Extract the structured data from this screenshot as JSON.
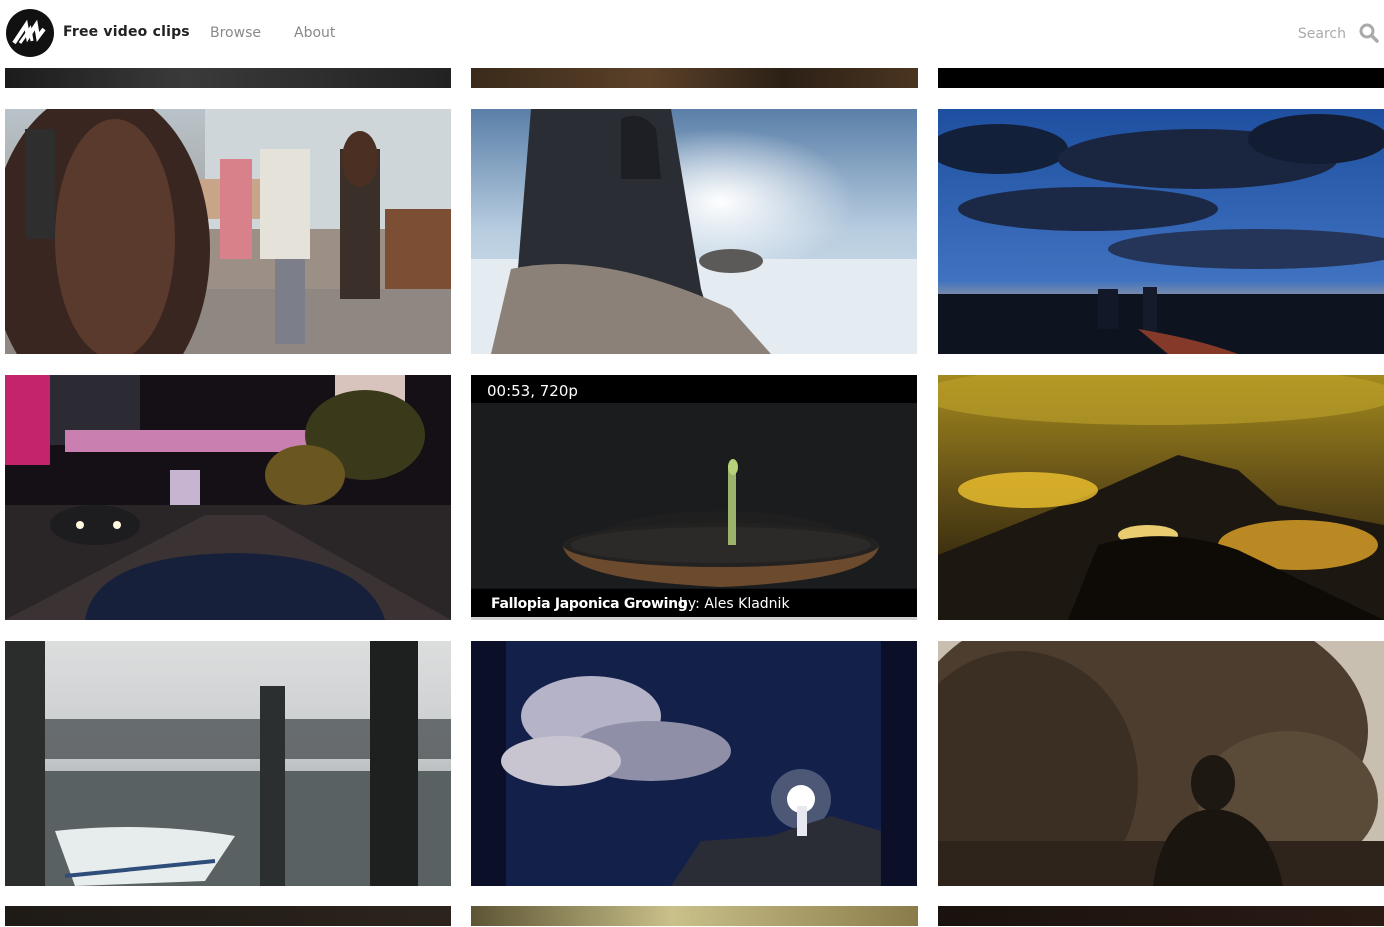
{
  "header": {
    "brand": "Free video clips",
    "nav": [
      "Browse",
      "About"
    ],
    "search_placeholder": "Search"
  },
  "icons": {
    "logo": "logo-icon",
    "search": "search-icon"
  },
  "hovered_clip": {
    "meta": "00:53, 720p",
    "title": "Fallopia Japonica Growing",
    "author": "by: Ales Kladnik"
  }
}
